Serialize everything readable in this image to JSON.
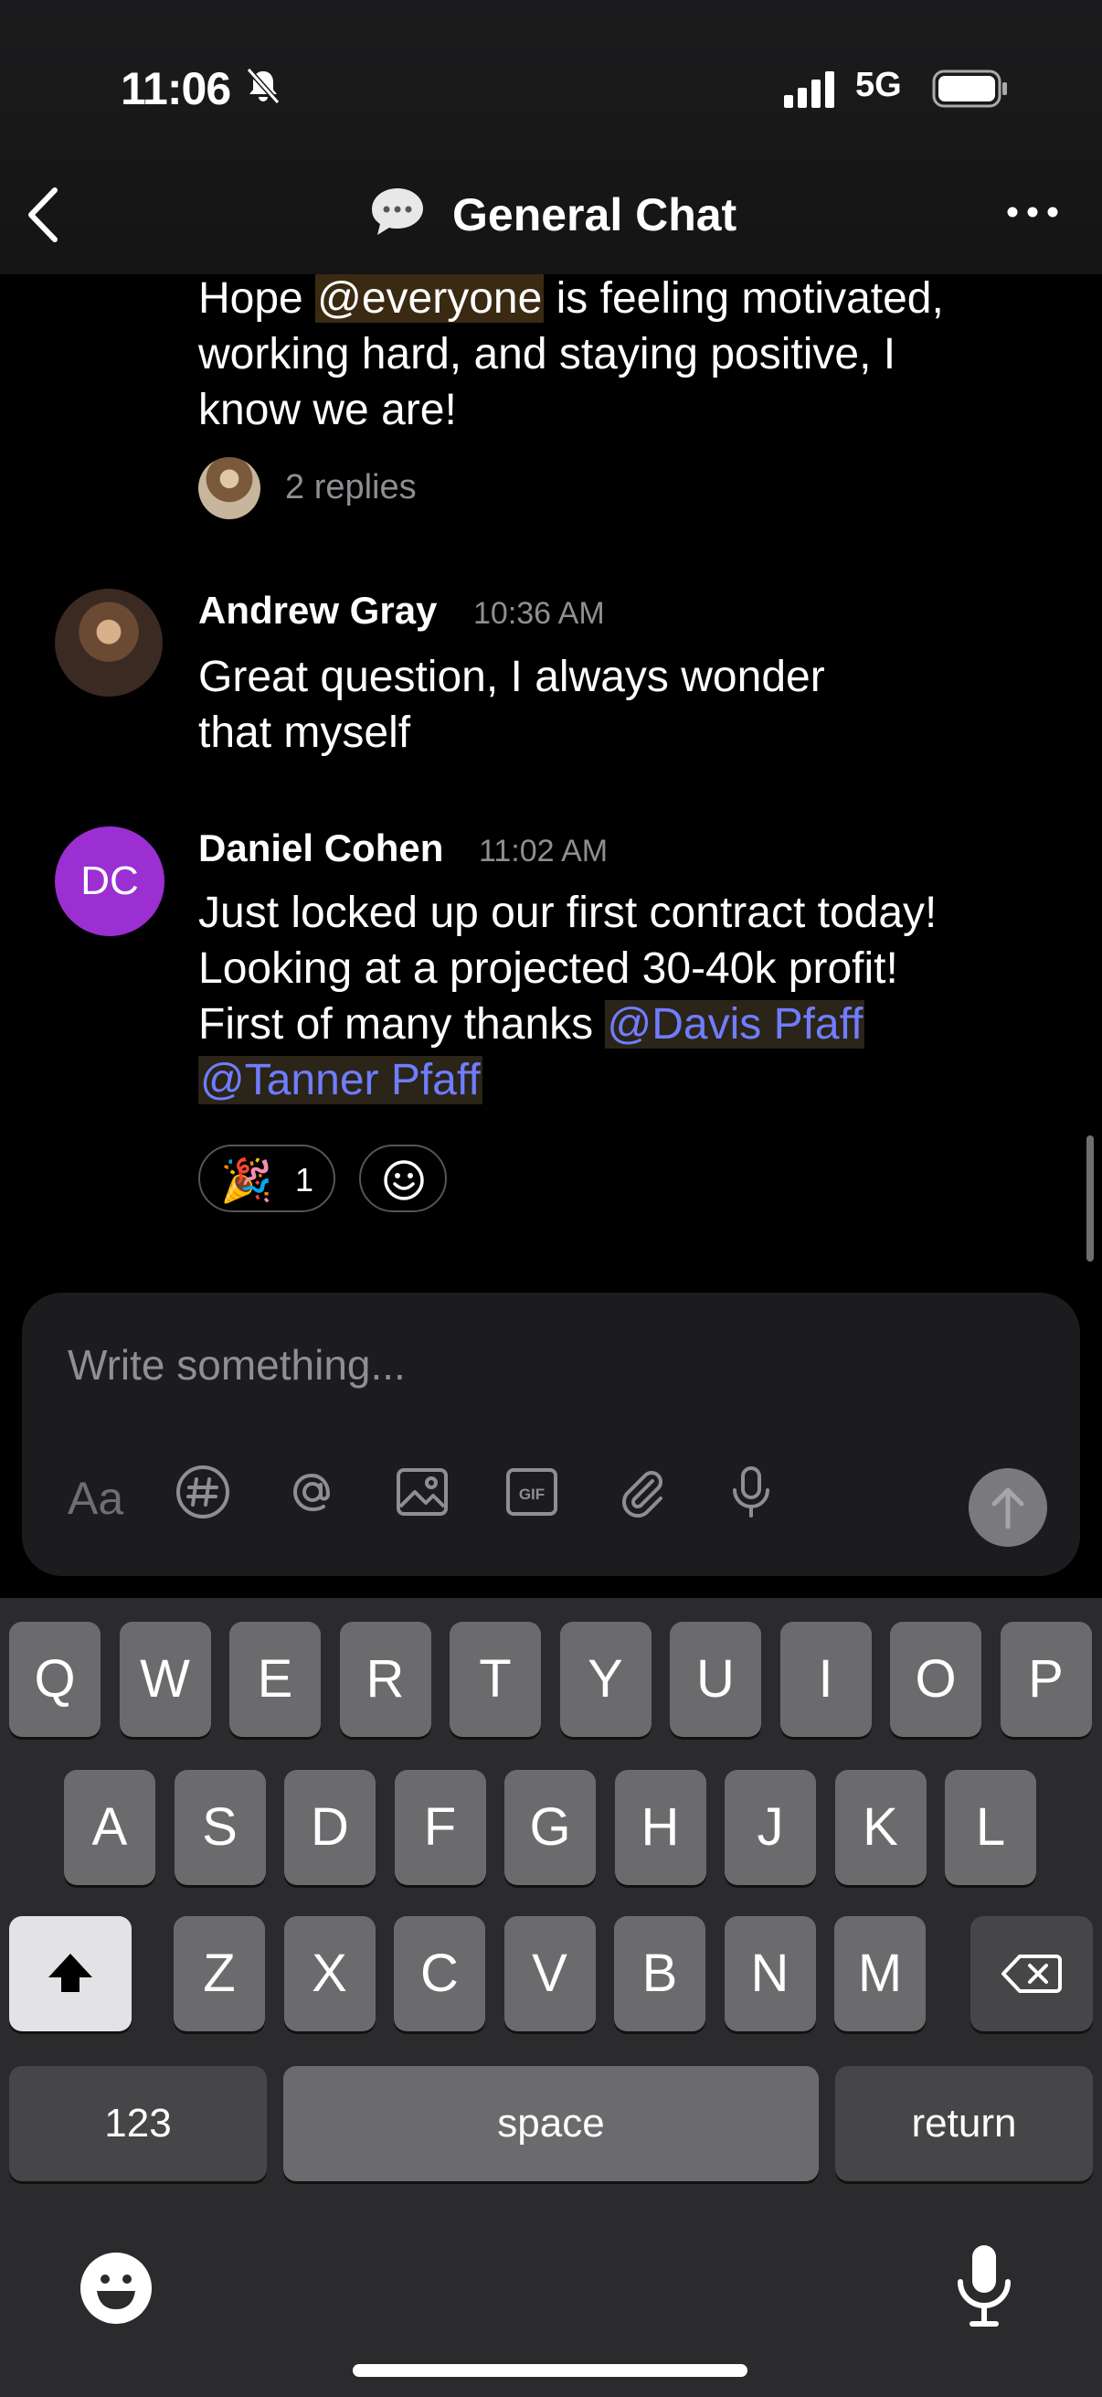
{
  "status_bar": {
    "time": "11:06",
    "network": "5G"
  },
  "nav": {
    "title": "General Chat",
    "back_icon": "chevron-left-icon",
    "more_icon": "ellipsis-icon"
  },
  "messages": [
    {
      "line1_before": "Hope ",
      "mention": "@everyone",
      "line1_after": " is feeling motivated,",
      "line2": "working hard, and staying positive, I",
      "line3": "know we are!",
      "replies": "2 replies"
    },
    {
      "sender": "Andrew Gray",
      "time": "10:36 AM",
      "line1": "Great question, I always wonder",
      "line2": "that myself"
    },
    {
      "sender": "Daniel Cohen",
      "initials": "DC",
      "time": "11:02 AM",
      "line1": "Just locked up our first contract today!",
      "line2": "Looking at a projected 30-40k profit!",
      "line3_before": "First of many thanks ",
      "mention1": "@Davis Pfaff",
      "mention2": "@Tanner Pfaff",
      "reaction_emoji": "🎉",
      "reaction_count": "1"
    }
  ],
  "composer": {
    "placeholder": "Write something...",
    "format_label": "Aa",
    "tools": [
      "hashtag-icon",
      "mention-icon",
      "image-icon",
      "gif-icon",
      "paperclip-icon",
      "microphone-icon"
    ]
  },
  "keyboard": {
    "row1": [
      "Q",
      "W",
      "E",
      "R",
      "T",
      "Y",
      "U",
      "I",
      "O",
      "P"
    ],
    "row2": [
      "A",
      "S",
      "D",
      "F",
      "G",
      "H",
      "J",
      "K",
      "L"
    ],
    "row3": [
      "Z",
      "X",
      "C",
      "V",
      "B",
      "N",
      "M"
    ],
    "numbers": "123",
    "space": "space",
    "return": "return"
  },
  "colors": {
    "accent_mention": "#6f7dff",
    "avatar_dc": "#9b2fd2"
  }
}
